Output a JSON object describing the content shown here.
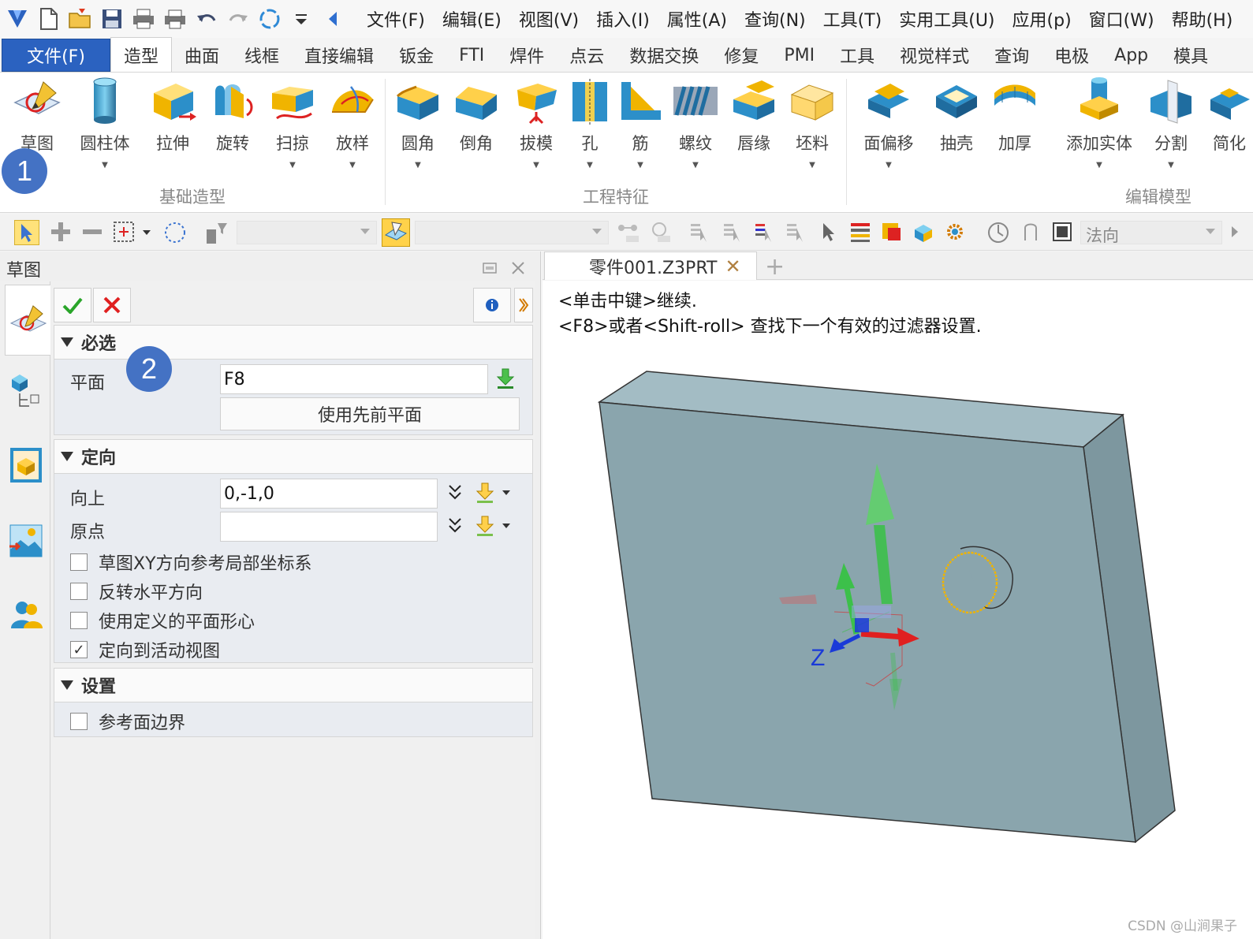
{
  "menubar": {
    "items": [
      "文件(F)",
      "编辑(E)",
      "视图(V)",
      "插入(I)",
      "属性(A)",
      "查询(N)",
      "工具(T)",
      "实用工具(U)",
      "应用(p)",
      "窗口(W)",
      "帮助(H)"
    ]
  },
  "tabs": {
    "file": "文件(F)",
    "items": [
      "造型",
      "曲面",
      "线框",
      "直接编辑",
      "钣金",
      "FTI",
      "焊件",
      "点云",
      "数据交换",
      "修复",
      "PMI",
      "工具",
      "视觉样式",
      "查询",
      "电极",
      "App",
      "模具"
    ],
    "active": "造型"
  },
  "ribbon": {
    "groups": [
      {
        "title": "基础造型",
        "buttons": [
          "草图",
          "圆柱体",
          "拉伸",
          "旋转",
          "扫掠",
          "放样"
        ]
      },
      {
        "title": "工程特征",
        "buttons": [
          "圆角",
          "倒角",
          "拔模",
          "孔",
          "筋",
          "螺纹",
          "唇缘",
          "坯料"
        ]
      },
      {
        "title": "编辑模型",
        "buttons": [
          "面偏移",
          "抽壳",
          "加厚",
          "添加实体",
          "分割",
          "简化"
        ]
      }
    ]
  },
  "badges": {
    "one": "1",
    "two": "2"
  },
  "toolbar": {
    "filter_text": "法向"
  },
  "panel": {
    "title": "草图",
    "required": {
      "header": "必选",
      "plane_label": "平面",
      "plane_value": "F8",
      "use_prev_button": "使用先前平面"
    },
    "orientation": {
      "header": "定向",
      "up_label": "向上",
      "up_value": "0,-1,0",
      "origin_label": "原点",
      "origin_value": "",
      "checkboxes": [
        {
          "label": "草图XY方向参考局部坐标系",
          "checked": false
        },
        {
          "label": "反转水平方向",
          "checked": false
        },
        {
          "label": "使用定义的平面形心",
          "checked": false
        },
        {
          "label": "定向到活动视图",
          "checked": true
        }
      ]
    },
    "settings": {
      "header": "设置",
      "checkboxes": [
        {
          "label": "参考面边界",
          "checked": false
        }
      ]
    }
  },
  "document": {
    "tab_title": "零件001.Z3PRT",
    "prompt_line1": "<单击中键>继续.",
    "prompt_line2": "<F8>或者<Shift-roll> 查找下一个有效的过滤器设置.",
    "axis_label": "Z",
    "watermark": "CSDN @山涧果子"
  },
  "colors": {
    "file_tab": "#2b62c0",
    "badge": "#4472c4",
    "part_face": "#8aa5ad",
    "part_top": "#a3bcc4",
    "part_side": "#7d979f",
    "axis_green": "#3cc04a",
    "axis_red": "#e02020",
    "axis_blue": "#1a3ad8",
    "highlight": "#f0b400"
  }
}
